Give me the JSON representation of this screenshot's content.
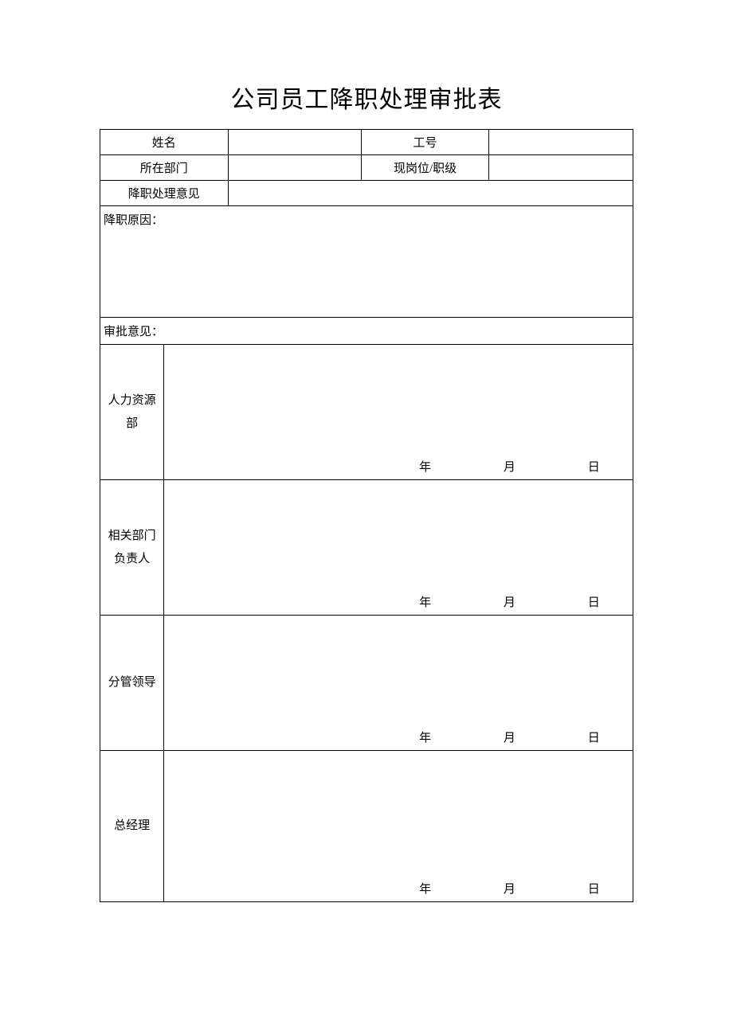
{
  "title": "公司员工降职处理审批表",
  "fields": {
    "name_label": "姓名",
    "name_value": "",
    "emp_no_label": "工号",
    "emp_no_value": "",
    "dept_label": "所在部门",
    "dept_value": "",
    "pos_label": "现岗位/职级",
    "pos_value": "",
    "demotion_opinion_label": "降职处理意见",
    "demotion_opinion_value": "",
    "reason_label": "降职原因：",
    "approval_label": "审批意见："
  },
  "approvals": [
    {
      "role": "人力资源\n部"
    },
    {
      "role": "相关部门\n负责人"
    },
    {
      "role": "分管领导"
    },
    {
      "role": "总经理"
    }
  ],
  "date_units": {
    "year": "年",
    "month": "月",
    "day": "日"
  }
}
